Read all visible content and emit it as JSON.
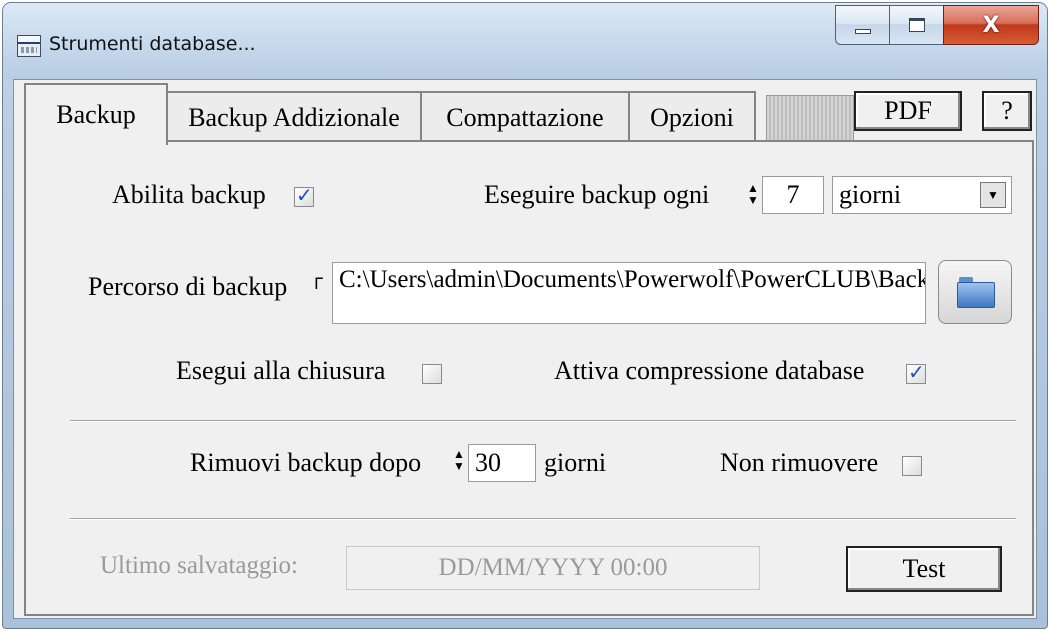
{
  "window": {
    "title": "Strumenti database...",
    "icon": "database-tools-icon",
    "controls": {
      "minimize_icon": "minimize-icon",
      "maximize_icon": "maximize-icon",
      "close_label": "X"
    }
  },
  "tabs": [
    {
      "label": "Backup",
      "active": true
    },
    {
      "label": "Backup Addizionale",
      "active": false
    },
    {
      "label": "Compattazione",
      "active": false
    },
    {
      "label": "Opzioni",
      "active": false
    }
  ],
  "toolbar": {
    "pdf_label": "PDF",
    "help_label": "?"
  },
  "backup": {
    "enable_label": "Abilita backup",
    "enable_checked": true,
    "every_label": "Eseguire backup ogni",
    "every_value": "7",
    "every_unit": "giorni",
    "path_label": "Percorso di backup",
    "path_value": "C:\\Users\\admin\\Documents\\Powerwolf\\PowerCLUB\\Backup",
    "on_close_label": "Esegui alla chiusura",
    "on_close_checked": false,
    "compress_label": "Attiva compressione database",
    "compress_checked": true,
    "remove_label": "Rimuovi backup dopo",
    "remove_value": "30",
    "remove_unit": "giorni",
    "no_remove_label": "Non rimuovere",
    "no_remove_checked": false,
    "last_save_label": "Ultimo salvataggio:",
    "last_save_value": "DD/MM/YYYY 00:00",
    "test_label": "Test"
  }
}
